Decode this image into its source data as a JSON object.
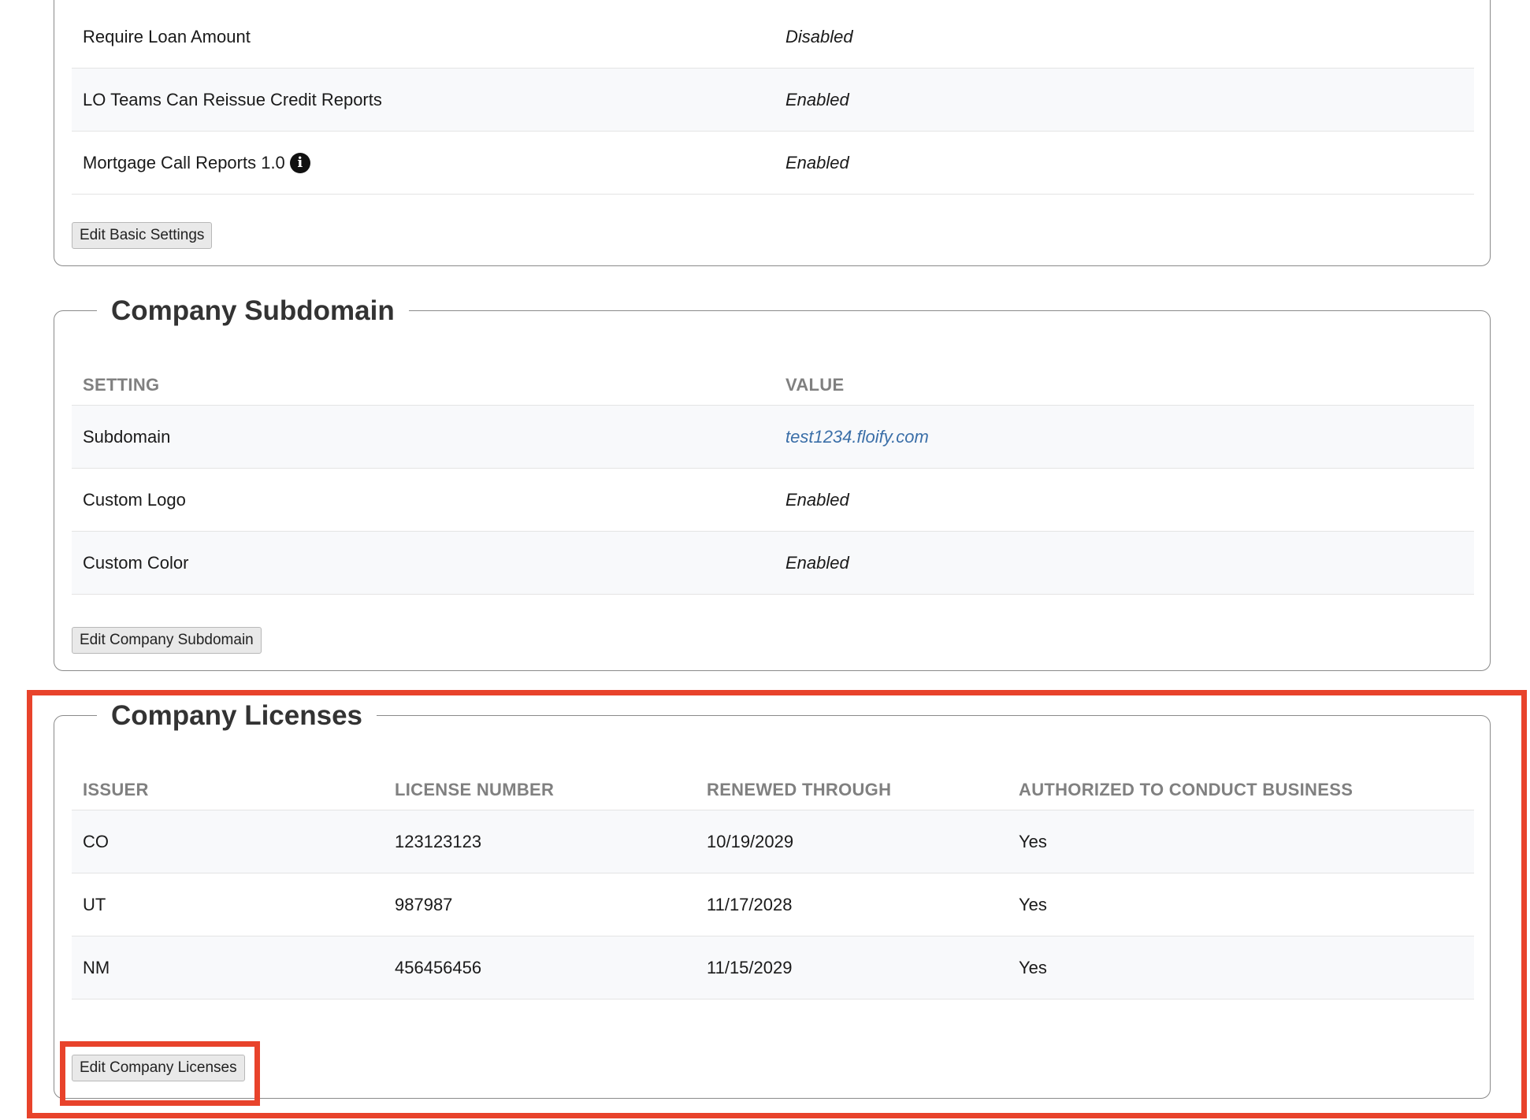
{
  "basic_settings": {
    "rows": [
      {
        "setting": "Require Loan Amount",
        "value": "Disabled"
      },
      {
        "setting": "LO Teams Can Reissue Credit Reports",
        "value": "Enabled"
      },
      {
        "setting": "Mortgage Call Reports 1.0",
        "value": "Enabled",
        "icon": "info-icon"
      }
    ],
    "edit_label": "Edit Basic Settings"
  },
  "subdomain": {
    "title": "Company Subdomain",
    "headers": {
      "setting": "SETTING",
      "value": "VALUE"
    },
    "rows": [
      {
        "setting": "Subdomain",
        "value": "test1234.floify.com"
      },
      {
        "setting": "Custom Logo",
        "value": "Enabled"
      },
      {
        "setting": "Custom Color",
        "value": "Enabled"
      }
    ],
    "edit_label": "Edit Company Subdomain"
  },
  "licenses": {
    "title": "Company Licenses",
    "headers": {
      "issuer": "ISSUER",
      "license_number": "LICENSE NUMBER",
      "renewed_through": "RENEWED THROUGH",
      "authorized": "AUTHORIZED TO CONDUCT BUSINESS"
    },
    "rows": [
      {
        "issuer": "CO",
        "license_number": "123123123",
        "renewed_through": "10/19/2029",
        "authorized": "Yes"
      },
      {
        "issuer": "UT",
        "license_number": "987987",
        "renewed_through": "11/17/2028",
        "authorized": "Yes"
      },
      {
        "issuer": "NM",
        "license_number": "456456456",
        "renewed_through": "11/15/2029",
        "authorized": "Yes"
      }
    ],
    "edit_label": "Edit Company Licenses"
  },
  "colors": {
    "highlight": "#e8432b",
    "link": "#3b6fa8",
    "header_text": "#808080"
  }
}
